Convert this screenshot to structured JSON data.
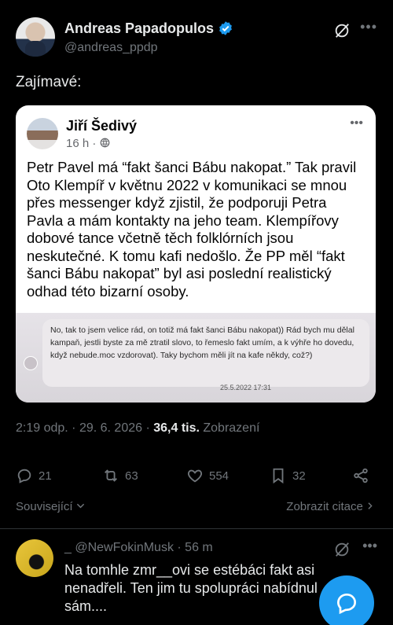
{
  "author": {
    "name": "Andreas Papadopulos",
    "handle": "@andreas_ppdp"
  },
  "tweet": {
    "text": "Zajímavé:"
  },
  "embedded_post": {
    "name": "Jiří Šedivý",
    "meta": "16 h · ",
    "more": "•••",
    "body": "Petr Pavel má “fakt šanci Bábu nakopat.” Tak pravil Oto Klempíř v květnu 2022 v komunikaci se mnou přes messenger když zjistil, že podporuji Petra Pavla a mám kontakty na jeho team. Klempířovy dobové tance včetně těch folklórních jsou neskutečné. K tomu kafi nedošlo. Že PP měl “fakt šanci Bábu nakopat” byl asi poslední realistický odhad této bizarní osoby.",
    "chat_message": "No, tak to jsem velice rád, on totiž má fakt šanci Bábu nakopat)) Rád bych mu dělal kampaň, jestli byste za mě ztratil slovo, to řemeslo fakt umím, a k výhře ho dovedu, když nebude.moc vzdorovat). Taky bychom měli jít na kafe někdy, což?)",
    "chat_date": "25.5.2022 17:31"
  },
  "meta": {
    "time": "2:19 odp. · 29. 6. 2026 · ",
    "views_value": "36,4 tis.",
    "views_label": " Zobrazení"
  },
  "actions": {
    "replies": "21",
    "reposts": "63",
    "likes": "554",
    "bookmarks": "32"
  },
  "links": {
    "related": "Související",
    "quotes": "Zobrazit citace"
  },
  "reply": {
    "handle": "_ @NewFokinMusk · 56 m",
    "text": "Na tomhle zmr__ovi se estébáci fakt asi nenadřeli. Ten jim tu spolupráci nabídnul sám...."
  },
  "more_glyph": "•••",
  "colors": {
    "accent": "#1d9bf0",
    "muted": "#71767b",
    "background": "#000000"
  },
  "icons": [
    "verified-badge-icon",
    "grok-icon",
    "more-icon",
    "globe-icon",
    "reply-icon",
    "repost-icon",
    "like-icon",
    "bookmark-icon",
    "share-icon",
    "chevron-down-icon",
    "chevron-right-icon",
    "compose-reply-icon"
  ]
}
